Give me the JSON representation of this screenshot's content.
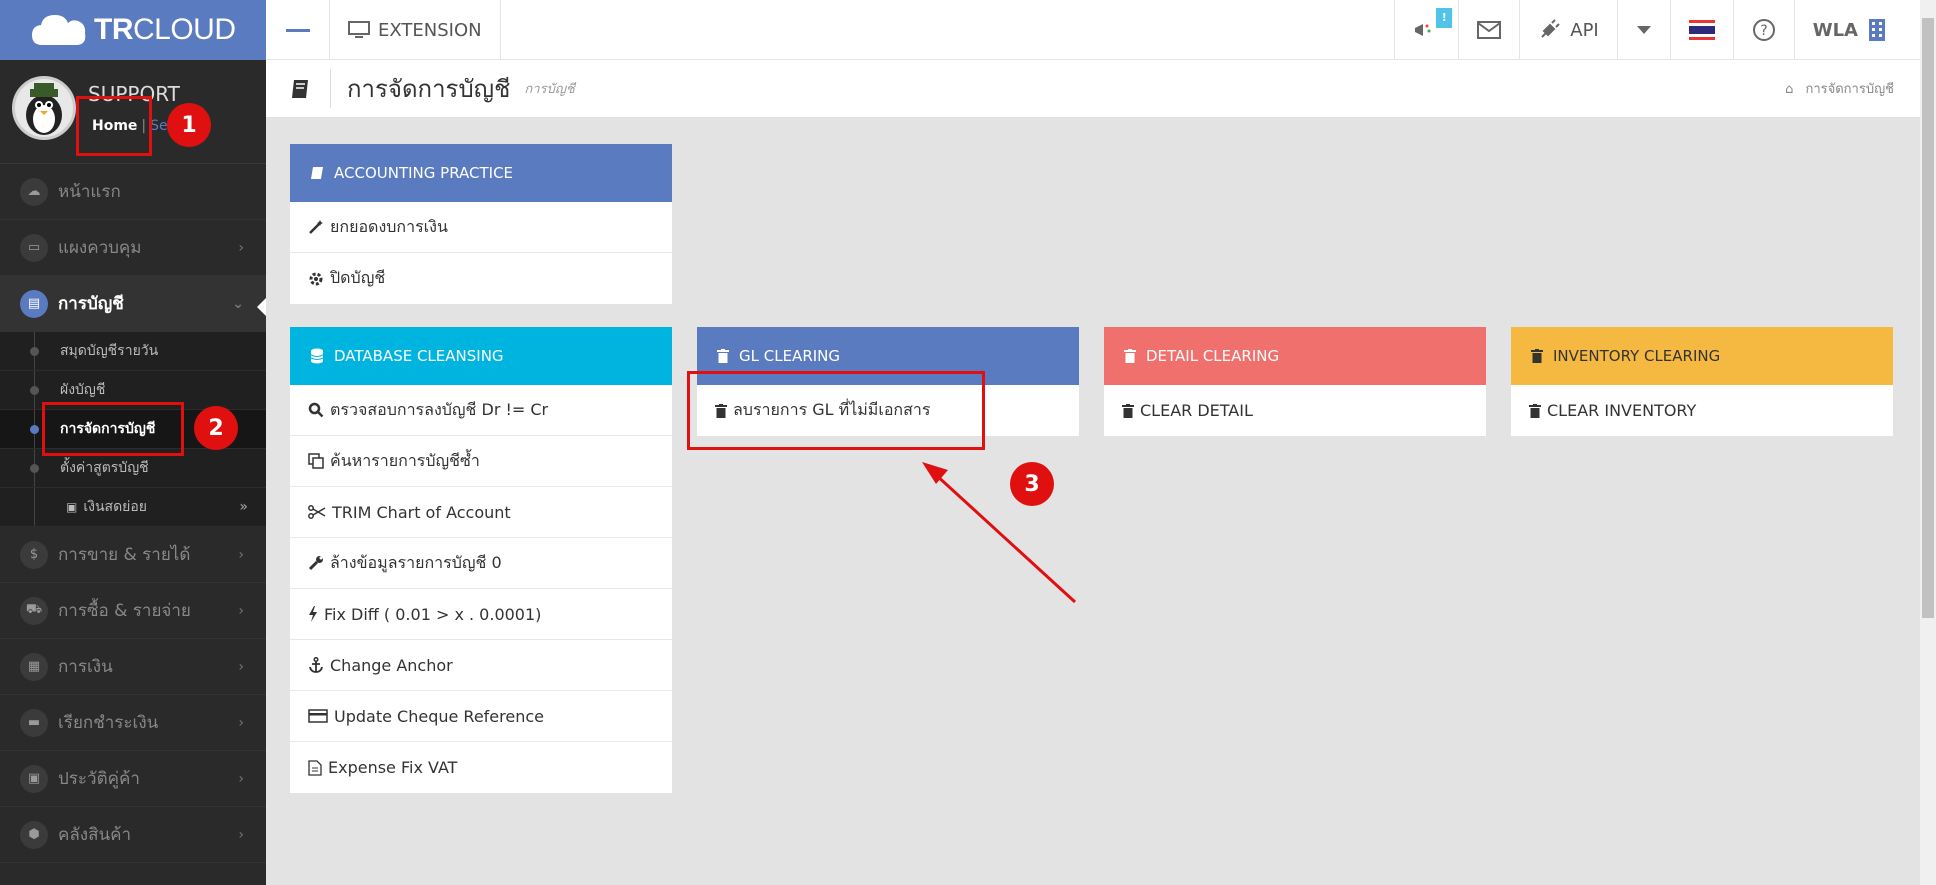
{
  "topbar": {
    "logo_bold": "TR",
    "logo_light": "CLOUD",
    "extension_label": "EXTENSION",
    "notification_badge": "!",
    "api_label": "API",
    "user_label": "WLA"
  },
  "sidebar": {
    "profile_name": "SUPPORT",
    "home_link": "Home",
    "second_link": "Se",
    "items": [
      {
        "label": "หน้าแรก"
      },
      {
        "label": "แผงควบคุม"
      },
      {
        "label": "การบัญชี"
      },
      {
        "label": "การขาย & รายได้"
      },
      {
        "label": "การซื้อ & รายจ่าย"
      },
      {
        "label": "การเงิน"
      },
      {
        "label": "เรียกชำระเงิน"
      },
      {
        "label": "ประวัติคู่ค้า"
      },
      {
        "label": "คลังสินค้า"
      }
    ],
    "subitems": [
      {
        "label": "สมุดบัญชีรายวัน"
      },
      {
        "label": "ผังบัญชี"
      },
      {
        "label": "การจัดการบัญชี"
      },
      {
        "label": "ตั้งค่าสูตรบัญชี"
      },
      {
        "label": "เงินสดย่อย"
      }
    ]
  },
  "page": {
    "title": "การจัดการบัญชี",
    "subtitle": "การบัญชี",
    "breadcrumb": "การจัดการบัญชี"
  },
  "panels": {
    "accounting_practice": {
      "title": "ACCOUNTING PRACTICE",
      "color": "#5a7bbf",
      "rows": [
        "ยกยอดงบการเงิน",
        "ปิดบัญชี"
      ]
    },
    "database_cleansing": {
      "title": "DATABASE CLEANSING",
      "color": "#00b4e0",
      "rows": [
        "ตรวจสอบการลงบัญชี Dr != Cr",
        "ค้นหารายการบัญชีซ้ำ",
        "TRIM Chart of Account",
        "ล้างข้อมูลรายการบัญชี 0",
        "Fix Diff ( 0.01 > x . 0.0001)",
        "Change Anchor",
        "Update Cheque Reference",
        "Expense Fix VAT"
      ]
    },
    "gl_clearing": {
      "title": "GL CLEARING",
      "color": "#5a7bbf",
      "rows": [
        "ลบรายการ GL ที่ไม่มีเอกสาร"
      ]
    },
    "detail_clearing": {
      "title": "DETAIL CLEARING",
      "color": "#f0706e",
      "rows": [
        "CLEAR DETAIL"
      ]
    },
    "inventory_clearing": {
      "title": "INVENTORY CLEARING",
      "color": "#f5b942",
      "rows": [
        "CLEAR INVENTORY"
      ]
    }
  },
  "annotations": {
    "n1": "1",
    "n2": "2",
    "n3": "3",
    "color": "#e01010"
  }
}
